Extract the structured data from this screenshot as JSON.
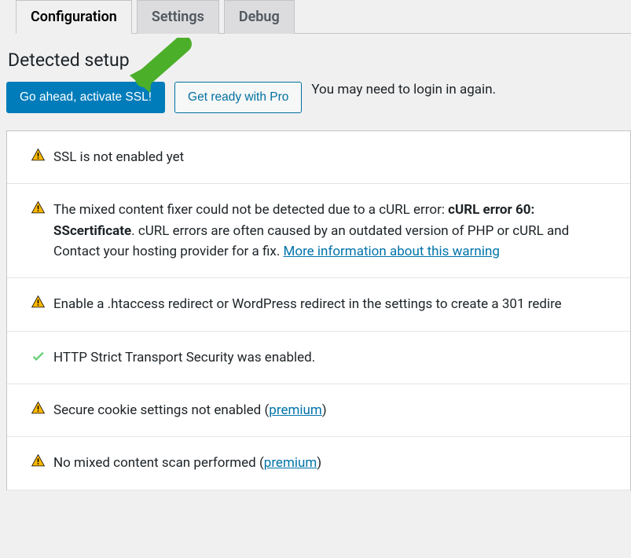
{
  "tabs": [
    {
      "label": "Configuration",
      "active": true
    },
    {
      "label": "Settings",
      "active": false
    },
    {
      "label": "Debug",
      "active": false
    }
  ],
  "heading": "Detected setup",
  "buttons": {
    "activate_label": "Go ahead, activate SSL!",
    "pro_label": "Get ready with Pro"
  },
  "note": "You may need to login in again.",
  "status_items": [
    {
      "icon": "warning",
      "text_parts": [
        {
          "t": "SSL is not enabled yet"
        }
      ]
    },
    {
      "icon": "warning",
      "text_parts": [
        {
          "t": "The mixed content fixer could not be detected due to a cURL error: "
        },
        {
          "t": "cURL error 60: SS",
          "bold": true
        },
        {
          "br": true
        },
        {
          "t": "certificate",
          "bold": true
        },
        {
          "t": ". cURL errors are often caused by an outdated version of PHP or cURL and "
        },
        {
          "br": true
        },
        {
          "t": "Contact your hosting provider for a fix. "
        },
        {
          "t": "More information about this warning",
          "link": true
        }
      ]
    },
    {
      "icon": "warning",
      "text_parts": [
        {
          "t": "Enable a .htaccess redirect or WordPress redirect in the settings to create a 301 redire"
        }
      ]
    },
    {
      "icon": "check",
      "text_parts": [
        {
          "t": "HTTP Strict Transport Security was enabled."
        }
      ]
    },
    {
      "icon": "warning",
      "text_parts": [
        {
          "t": "Secure cookie settings not enabled ("
        },
        {
          "t": "premium",
          "link": true
        },
        {
          "t": ")"
        }
      ]
    },
    {
      "icon": "warning",
      "text_parts": [
        {
          "t": "No mixed content scan performed ("
        },
        {
          "t": "premium",
          "link": true
        },
        {
          "t": ")"
        }
      ]
    }
  ]
}
